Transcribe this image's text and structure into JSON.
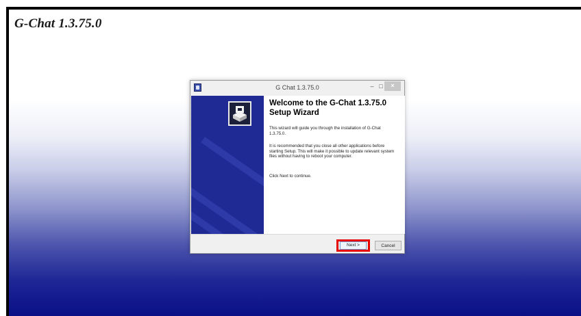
{
  "desktop": {
    "title": "G-Chat 1.3.75.0"
  },
  "window": {
    "title": "G Chat 1.3.75.0",
    "icon": "installer-icon",
    "controls": {
      "minimize": "–",
      "maximize": "□",
      "close": "×"
    }
  },
  "wizard": {
    "welcome": "Welcome to the G-Chat 1.3.75.0 Setup Wizard",
    "paragraphs": [
      "This wizard will guide you through the installation of G-Chat 1.3.75.0.",
      "It is recommended that you close all other applications before starting Setup. This will make it possible to update relevant system files without having to reboot your computer.",
      "Click Next to continue."
    ]
  },
  "buttons": {
    "next": "Next >",
    "cancel": "Cancel"
  },
  "colors": {
    "banner": "#1f2a94",
    "highlight": "#e60000",
    "desktop_bottom": "#0a0f86"
  }
}
